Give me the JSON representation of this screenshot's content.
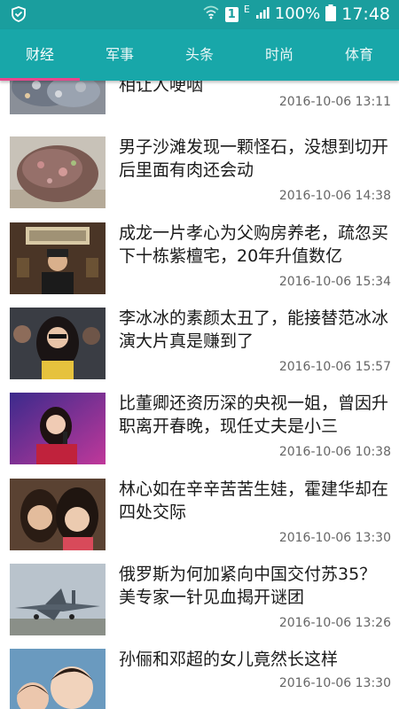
{
  "status_bar": {
    "network_badge": "1",
    "network_type": "E",
    "battery": "100%",
    "time": "17:48"
  },
  "tabs": [
    {
      "label": "财经",
      "active": true
    },
    {
      "label": "军事",
      "active": false
    },
    {
      "label": "头条",
      "active": false
    },
    {
      "label": "时尚",
      "active": false
    },
    {
      "label": "体育",
      "active": false
    }
  ],
  "news": [
    {
      "title": "相让人哽咽",
      "time": "2016-10-06 13:11",
      "thumb": "stone-pile-photo"
    },
    {
      "title": "男子沙滩发现一颗怪石，没想到切开后里面有肉还会动",
      "time": "2016-10-06 14:38",
      "thumb": "odd-rock-photo"
    },
    {
      "title": "成龙一片孝心为父购房养老，疏忽买下十栋紫檀宅，20年升值数亿",
      "time": "2016-10-06 15:34",
      "thumb": "jackie-chan-photo"
    },
    {
      "title": "李冰冰的素颜太丑了，能接替范冰冰演大片真是赚到了",
      "time": "2016-10-06 15:57",
      "thumb": "li-bingbing-photo"
    },
    {
      "title": "比董卿还资历深的央视一姐，曾因升职离开春晚，现任丈夫是小三",
      "time": "2016-10-06 10:38",
      "thumb": "cctv-host-photo"
    },
    {
      "title": "林心如在辛辛苦苦生娃，霍建华却在四处交际",
      "time": "2016-10-06 13:30",
      "thumb": "couple-selfie-photo"
    },
    {
      "title": "俄罗斯为何加紧向中国交付苏35？美专家一针见血揭开谜团",
      "time": "2016-10-06 13:26",
      "thumb": "fighter-jet-photo"
    },
    {
      "title": "孙俪和邓超的女儿竟然长这样",
      "time": "2016-10-06 13:30",
      "thumb": "children-photo"
    }
  ]
}
